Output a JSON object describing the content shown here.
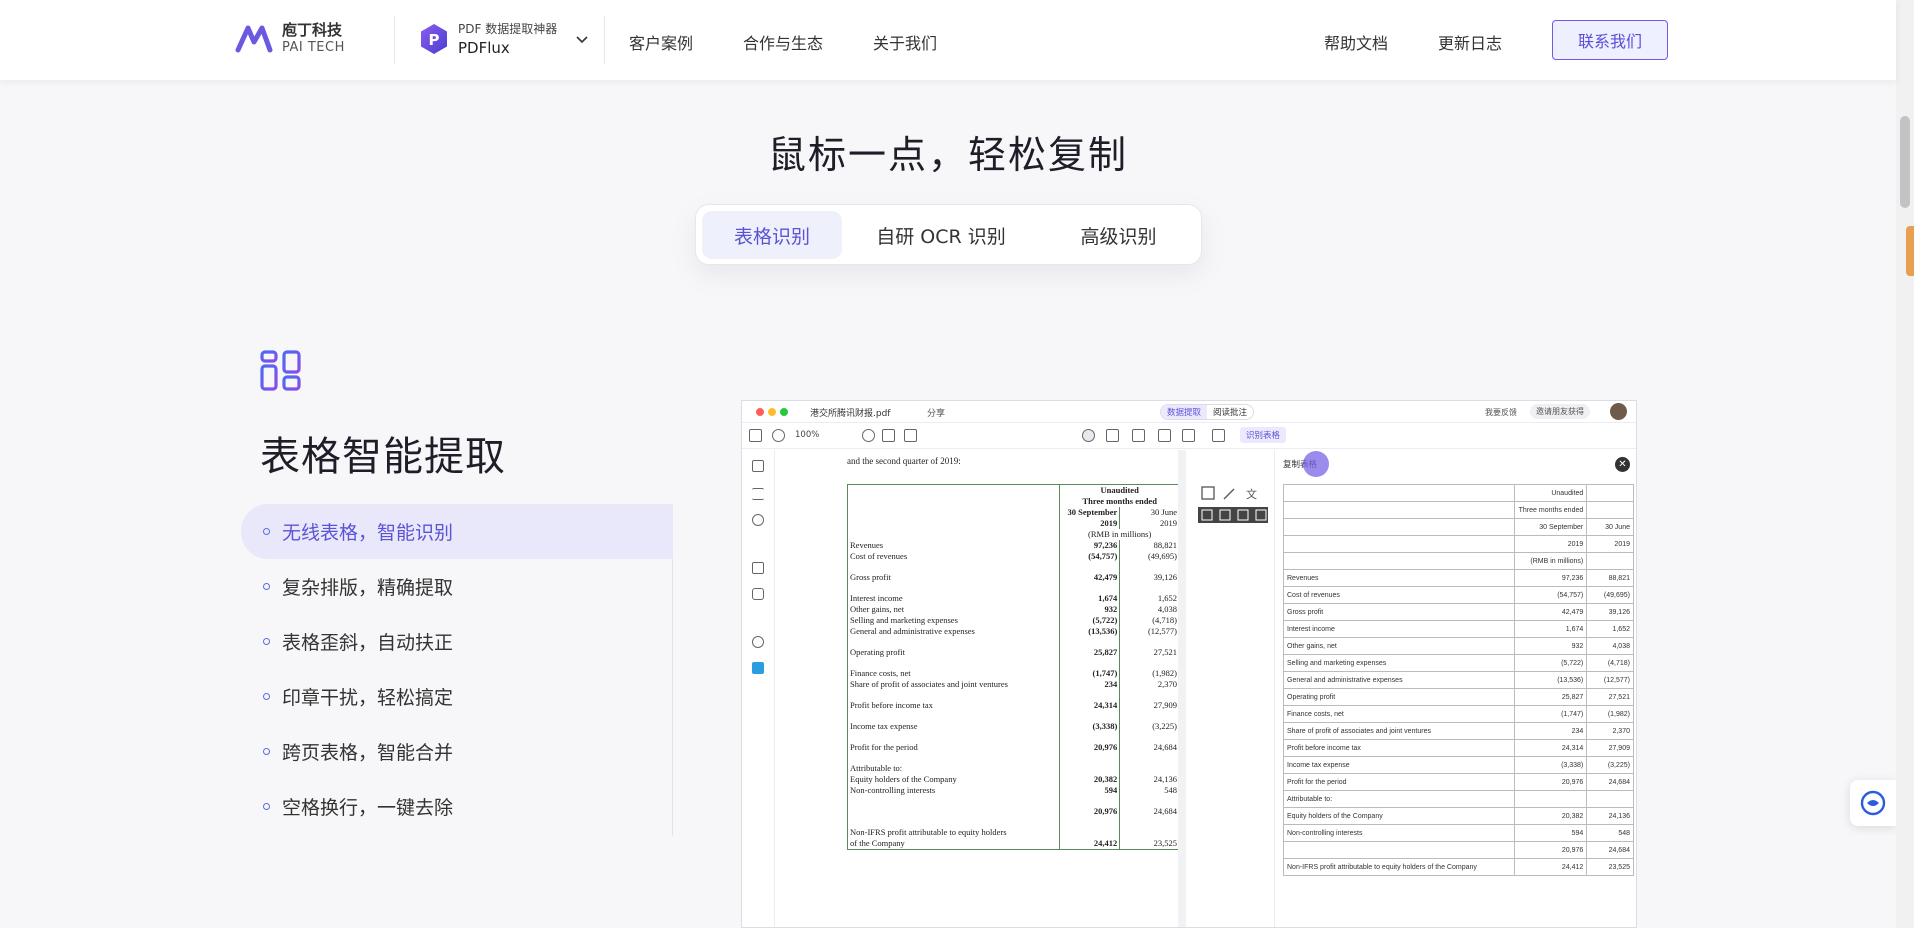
{
  "header": {
    "logo_cn": "庖丁科技",
    "logo_en": "PAI TECH",
    "product_sub": "PDF 数据提取神器",
    "product_name": "PDFlux",
    "nav": [
      "客户案例",
      "合作与生态",
      "关于我们"
    ],
    "help": "帮助文档",
    "changelog": "更新日志",
    "contact": "联系我们",
    "accent": "#5b53d6"
  },
  "section": {
    "title": "鼠标一点，轻松复制",
    "tabs": [
      "表格识别",
      "自研 OCR 识别",
      "高级识别"
    ],
    "active_tab": "表格识别"
  },
  "feature": {
    "title": "表格智能提取",
    "items": [
      "无线表格，智能识别",
      "复杂排版，精确提取",
      "表格歪斜，自动扶正",
      "印章干扰，轻松搞定",
      "跨页表格，智能合并",
      "空格换行，一键去除"
    ]
  },
  "app": {
    "file": "港交所腾讯财报.pdf",
    "share": "分享",
    "seg": [
      "数据提取",
      "阅读批注"
    ],
    "feedback": "我要反馈",
    "invite": "邀请朋友获得",
    "zoom": "100%",
    "recog": "识别表格",
    "copy": "复制表格",
    "close": "✕",
    "pdf_intro": "and the second quarter of 2019:",
    "pdf_header": [
      "Unaudited",
      "Three months ended",
      "30 September",
      "30 June",
      "2019",
      "2019",
      "(RMB in millions)"
    ],
    "pdf_rows": [
      [
        "Revenues",
        "97,236",
        "88,821"
      ],
      [
        "Cost of revenues",
        "(54,757)",
        "(49,695)"
      ],
      [
        "",
        "",
        ""
      ],
      [
        "Gross profit",
        "42,479",
        "39,126"
      ],
      [
        "",
        "",
        ""
      ],
      [
        "Interest income",
        "1,674",
        "1,652"
      ],
      [
        "Other gains, net",
        "932",
        "4,038"
      ],
      [
        "Selling and marketing expenses",
        "(5,722)",
        "(4,718)"
      ],
      [
        "General and administrative expenses",
        "(13,536)",
        "(12,577)"
      ],
      [
        "",
        "",
        ""
      ],
      [
        "Operating profit",
        "25,827",
        "27,521"
      ],
      [
        "",
        "",
        ""
      ],
      [
        "Finance costs, net",
        "(1,747)",
        "(1,982)"
      ],
      [
        "Share of profit of associates and joint ventures",
        "234",
        "2,370"
      ],
      [
        "",
        "",
        ""
      ],
      [
        "Profit before income tax",
        "24,314",
        "27,909"
      ],
      [
        "",
        "",
        ""
      ],
      [
        "Income tax expense",
        "(3,338)",
        "(3,225)"
      ],
      [
        "",
        "",
        ""
      ],
      [
        "Profit for the period",
        "20,976",
        "24,684"
      ],
      [
        "",
        "",
        ""
      ],
      [
        "Attributable to:",
        "",
        ""
      ],
      [
        "  Equity holders of the Company",
        "20,382",
        "24,136"
      ],
      [
        "  Non-controlling interests",
        "594",
        "548"
      ],
      [
        "",
        "",
        ""
      ],
      [
        "",
        "20,976",
        "24,684"
      ],
      [
        "",
        "",
        ""
      ],
      [
        "Non-IFRS profit attributable to equity holders",
        "",
        ""
      ],
      [
        "  of the Company",
        "24,412",
        "23,525"
      ]
    ],
    "res_rows": [
      [
        "",
        "Unaudited",
        ""
      ],
      [
        "",
        "Three months ended",
        ""
      ],
      [
        "",
        "30 September",
        "30 June"
      ],
      [
        "",
        "2019",
        "2019"
      ],
      [
        "",
        "(RMB in millions)",
        ""
      ],
      [
        "Revenues",
        "97,236",
        "88,821"
      ],
      [
        "Cost of revenues",
        "(54,757)",
        "(49,695)"
      ],
      [
        "Gross profit",
        "42,479",
        "39,126"
      ],
      [
        "Interest income",
        "1,674",
        "1,652"
      ],
      [
        "Other gains, net",
        "932",
        "4,038"
      ],
      [
        "Selling and marketing expenses",
        "(5,722)",
        "(4,718)"
      ],
      [
        "General and administrative expenses",
        "(13,536)",
        "(12,577)"
      ],
      [
        "Operating profit",
        "25,827",
        "27,521"
      ],
      [
        "Finance costs, net",
        "(1,747)",
        "(1,982)"
      ],
      [
        "Share of profit of associates and joint ventures",
        "234",
        "2,370"
      ],
      [
        "Profit before income tax",
        "24,314",
        "27,909"
      ],
      [
        "Income tax expense",
        "(3,338)",
        "(3,225)"
      ],
      [
        "Profit for the period",
        "20,976",
        "24,684"
      ],
      [
        "Attributable to:",
        "",
        ""
      ],
      [
        "    Equity holders of the Company",
        "20,382",
        "24,136"
      ],
      [
        "    Non-controlling interests",
        "594",
        "548"
      ],
      [
        "",
        "20,976",
        "24,684"
      ],
      [
        "Non-IFRS profit attributable to equity holders of the Company",
        "24,412",
        "23,525"
      ]
    ]
  }
}
